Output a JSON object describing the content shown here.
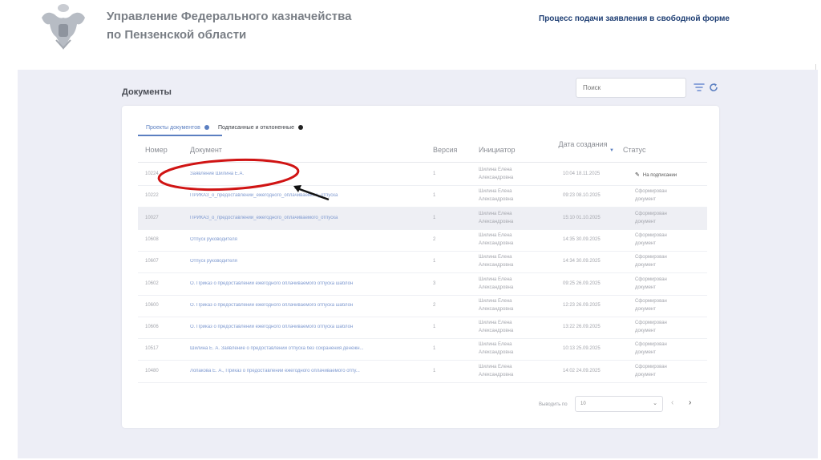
{
  "header": {
    "org_line1": "Управление Федерального казначейства",
    "org_line2": "по Пензенской области",
    "process_title": "Процесс подачи заявления в свободной форме"
  },
  "page": {
    "title": "Документы",
    "search_placeholder": "Поиск"
  },
  "tabs": [
    {
      "label": "Проекты документов",
      "dot_color": "#5b7fc1",
      "active": true
    },
    {
      "label": "Подписанные и отклоненные",
      "dot_color": "#222222",
      "active": false
    }
  ],
  "table": {
    "columns": {
      "num": "Номер",
      "doc": "Документ",
      "ver": "Версия",
      "init": "Инициатор",
      "date": "Дата создания",
      "status": "Статус"
    },
    "rows": [
      {
        "num": "10224",
        "doc": "Заявление Шилина Е.А.",
        "ver": "1",
        "init": "Шилина Елена\nАлександровна",
        "date": "10:04 18.11.2025",
        "status": "На подписании"
      },
      {
        "num": "10222",
        "doc": "ПРИКАЗ_о_предоставлении_ежегодного_оплачиваемого_отпуска",
        "ver": "1",
        "init": "Шилина Елена\nАлександровна",
        "date": "09:23 08.10.2025",
        "status": "Сформирован\nдокумент"
      },
      {
        "num": "10027",
        "doc": "ПРИКАЗ_о_предоставлении_ежегодного_оплачиваемого_отпуска",
        "ver": "1",
        "init": "Шилина Елена\nАлександровна",
        "date": "15:10 01.10.2025",
        "status": "Сформирован\nдокумент"
      },
      {
        "num": "10608",
        "doc": "Отпуск руководителя",
        "ver": "2",
        "init": "Шилина Елена\nАлександровна",
        "date": "14:35 30.09.2025",
        "status": "Сформирован\nдокумент"
      },
      {
        "num": "10607",
        "doc": "Отпуск руководителя",
        "ver": "1",
        "init": "Шилина Елена\nАлександровна",
        "date": "14:34 30.09.2025",
        "status": "Сформирован\nдокумент"
      },
      {
        "num": "10602",
        "doc": "О. Приказ о предоставлении ежегодного оплачиваемого отпуска шаблон",
        "ver": "3",
        "init": "Шилина Елена\nАлександровна",
        "date": "09:25 26.09.2025",
        "status": "Сформирован\nдокумент"
      },
      {
        "num": "10600",
        "doc": "О. Приказ о предоставлении ежегодного оплачиваемого отпуска шаблон",
        "ver": "2",
        "init": "Шилина Елена\nАлександровна",
        "date": "12:23 26.09.2025",
        "status": "Сформирован\nдокумент"
      },
      {
        "num": "10606",
        "doc": "О. Приказ о предоставлении ежегодного оплачиваемого отпуска шаблон",
        "ver": "1",
        "init": "Шилина Елена\nАлександровна",
        "date": "13:22 26.09.2025",
        "status": "Сформирован\nдокумент"
      },
      {
        "num": "10517",
        "doc": "Шилина Е. А. Заявление о предоставлении отпуска без сохранения денежн...",
        "ver": "1",
        "init": "Шилина Елена\nАлександровна",
        "date": "10:13 25.09.2025",
        "status": "Сформирован\nдокумент"
      },
      {
        "num": "10480",
        "doc": "Лопакова Е. А., Приказ о предоставлении ежегодного оплачиваемого отпу...",
        "ver": "1",
        "init": "Шилина Елена\nАлександровна",
        "date": "14:02 24.09.2025",
        "status": "Сформирован\nдокумент"
      }
    ]
  },
  "pagination": {
    "per_page_label": "Выводить по",
    "per_page_value": "10",
    "prev": "‹",
    "next": "›"
  }
}
